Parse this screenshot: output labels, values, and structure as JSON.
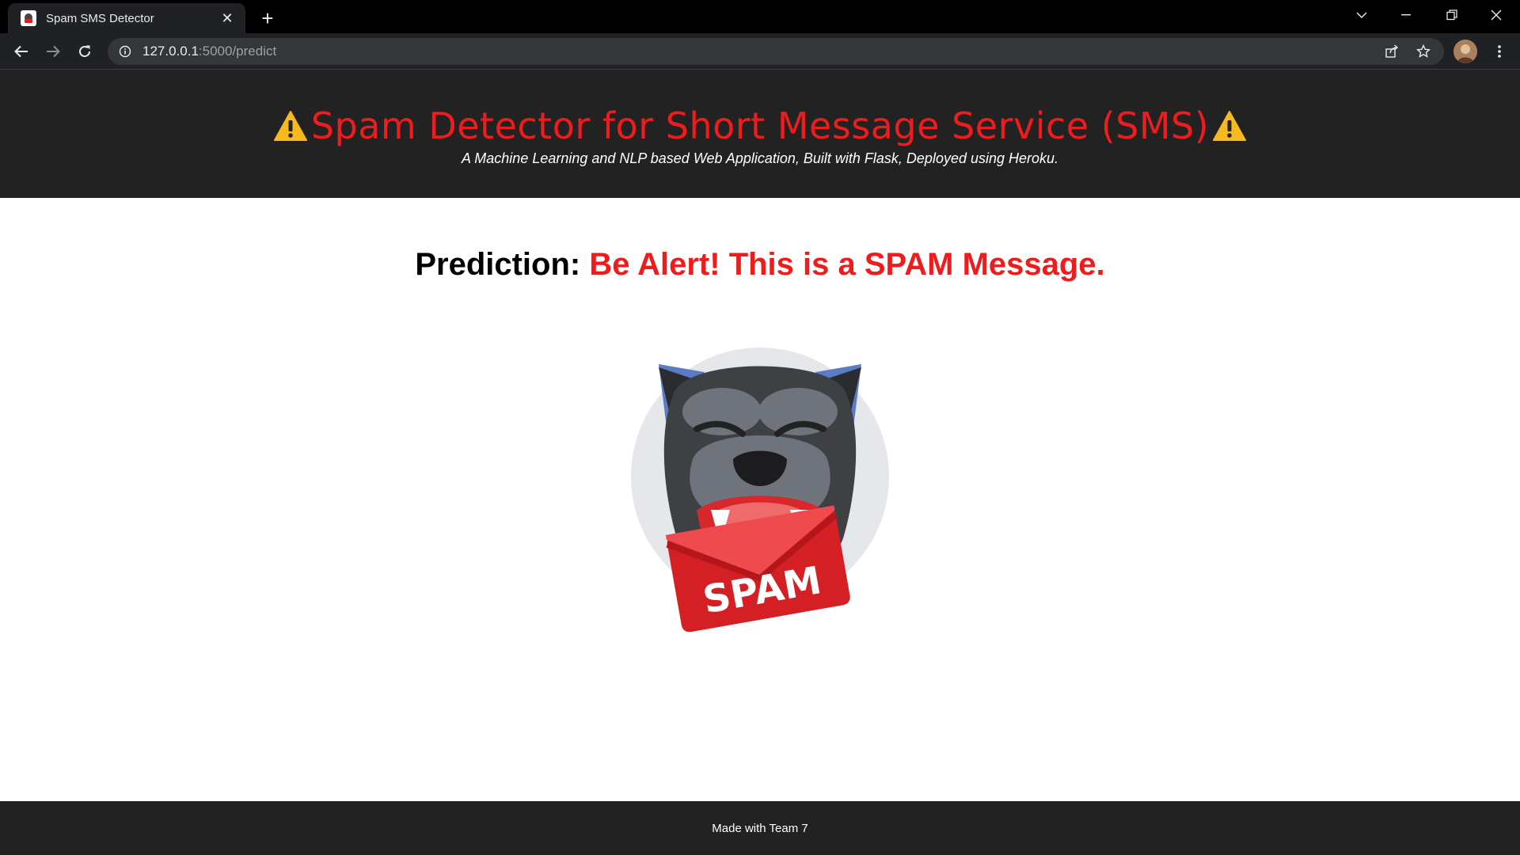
{
  "browser": {
    "tab_title": "Spam SMS Detector",
    "tab_close": "✕",
    "new_tab": "+",
    "url_host": "127.0.0.1",
    "url_rest": ":5000/predict"
  },
  "header": {
    "title": "Spam Detector for Short Message Service (SMS)",
    "subtitle": "A Machine Learning and NLP based Web Application, Built with Flask, Deployed using Heroku."
  },
  "result": {
    "label": "Prediction:",
    "value": "Be Alert! This is a SPAM Message."
  },
  "image": {
    "envelope_text": "SPAM"
  },
  "footer": {
    "text": "Made with Team 7"
  },
  "colors": {
    "alert_red": "#ee1c1c",
    "header_bg": "#222222",
    "warning_yellow": "#f6b91e"
  }
}
